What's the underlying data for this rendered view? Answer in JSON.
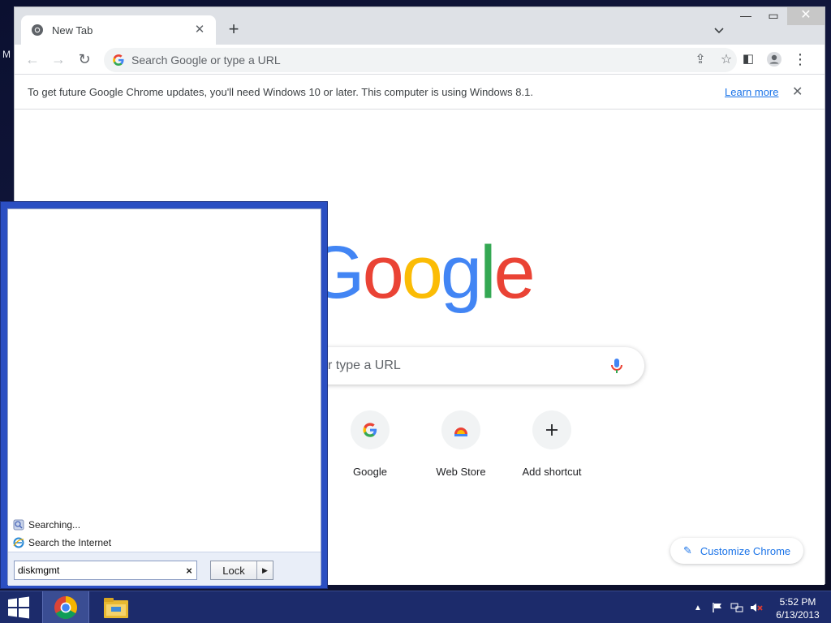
{
  "desktop": {
    "edge_text": "M"
  },
  "browser": {
    "tab": {
      "title": "New Tab"
    },
    "omnibox": {
      "placeholder": "Search Google or type a URL"
    },
    "infobar": {
      "message": "To get future Google Chrome updates, you'll need Windows 10 or later. This computer is using Windows 8.1.",
      "link": "Learn more"
    }
  },
  "new_tab_page": {
    "logo": {
      "g1": "G",
      "o1": "o",
      "o2": "o",
      "g2": "g",
      "l": "l",
      "e": "e"
    },
    "search_placeholder": "r type a URL",
    "shortcuts": [
      {
        "label": "Google"
      },
      {
        "label": "Web Store"
      },
      {
        "label": "Add shortcut"
      }
    ],
    "customize_label": "Customize Chrome"
  },
  "start_menu": {
    "results": [
      {
        "label": "Searching..."
      },
      {
        "label": "Search the Internet"
      }
    ],
    "search_value": "diskmgmt",
    "clear_symbol": "×",
    "power_button": {
      "label": "Lock"
    }
  },
  "taskbar": {
    "clock": {
      "time": "5:52 PM",
      "date": "6/13/2013"
    }
  },
  "colors": {
    "google_blue": "#4285f4",
    "google_red": "#ea4335",
    "google_yellow": "#fbbc05",
    "google_green": "#34a853",
    "start_menu_frame": "#2b4fc2",
    "taskbar": "#1c2b6b"
  }
}
